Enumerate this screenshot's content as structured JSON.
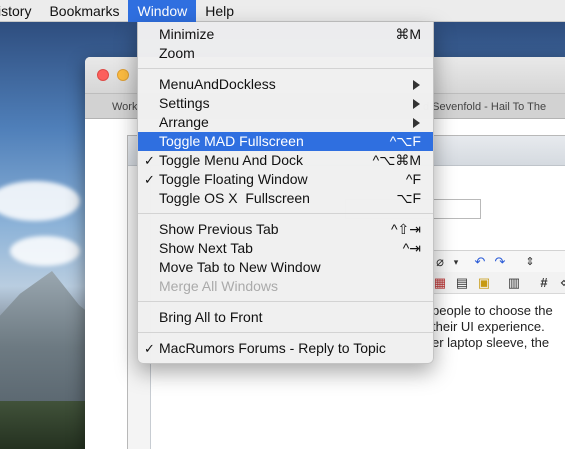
{
  "menubar": {
    "items": [
      "istory",
      "Bookmarks",
      "Window",
      "Help"
    ],
    "active": "Window"
  },
  "window": {
    "tab_left": "Work",
    "tab_right": "d Sevenfold - Hail To The",
    "body_lines": [
      "people to choose the",
      "their UI experience.",
      "er laptop sleeve, the"
    ]
  },
  "menu": {
    "minimize": {
      "label": "Minimize",
      "shortcut": "⌘M"
    },
    "zoom": {
      "label": "Zoom"
    },
    "menuanddockless": {
      "label": "MenuAndDockless"
    },
    "settings": {
      "label": "Settings"
    },
    "arrange": {
      "label": "Arrange"
    },
    "toggle_mad_fullscreen": {
      "label": "Toggle MAD Fullscreen",
      "shortcut": "^⌥F"
    },
    "toggle_menu_and_dock": {
      "label": "Toggle Menu And Dock",
      "shortcut": "^⌥⌘M",
      "checked": "✓"
    },
    "toggle_floating_window": {
      "label": "Toggle Floating Window",
      "shortcut": "^F",
      "checked": "✓"
    },
    "toggle_osx_fullscreen": {
      "label": "Toggle OS X  Fullscreen",
      "shortcut": "⌥F"
    },
    "show_previous_tab": {
      "label": "Show Previous Tab",
      "shortcut": "^⇧⇥"
    },
    "show_next_tab": {
      "label": "Show Next Tab",
      "shortcut": "^⇥"
    },
    "move_tab_to_new_window": {
      "label": "Move Tab to New Window"
    },
    "merge_all_windows": {
      "label": "Merge All Windows"
    },
    "bring_all_to_front": {
      "label": "Bring All to Front"
    },
    "macrumors_forums": {
      "label": "MacRumors Forums - Reply to Topic",
      "checked": "✓"
    }
  },
  "colors": {
    "highlight": "#2f6fe0",
    "menubar_bg": "#ececec"
  }
}
